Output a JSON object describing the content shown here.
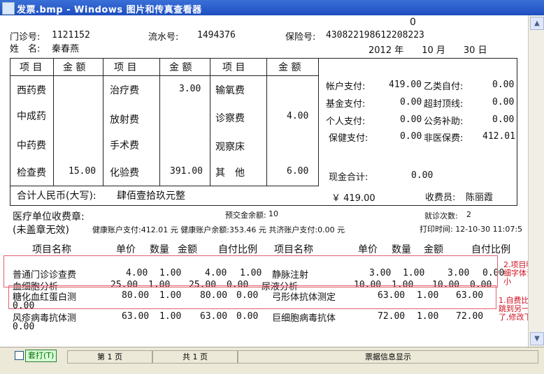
{
  "window": {
    "title": "发票.bmp - Windows 图片和传真查看器"
  },
  "scrollbar": {
    "up_icon": "▲",
    "down_icon": "▼"
  },
  "header": {
    "clinic_no_label": "门诊号:",
    "clinic_no": "1121152",
    "serial_label": "流水号:",
    "serial_no": "1494376",
    "insurance_label": "保险号:",
    "insurance_no": "430822198612208223",
    "name_label": "姓　名:",
    "name": "秦春燕",
    "date": "2012 年　　10 月　　30 日"
  },
  "fee_table": {
    "col_item": "项 目",
    "col_amount": "金 额",
    "rows": [
      [
        "西药费",
        "",
        "治疗费",
        "3.00",
        "输氧费",
        ""
      ],
      [
        "中成药",
        "",
        "放射费",
        "",
        "诊察费",
        "4.00"
      ],
      [
        "中药费",
        "",
        "手术费",
        "",
        "观察床",
        ""
      ],
      [
        "检查费",
        "15.00",
        "化验费",
        "391.00",
        "其　他",
        "6.00"
      ]
    ]
  },
  "payments": [
    {
      "label": "帐户支付:",
      "value": "419.00",
      "label2": "乙类自付:",
      "value2": "0.00"
    },
    {
      "label": "基金支付:",
      "value": "0.00",
      "label2": "超封顶线:",
      "value2": "0.00"
    },
    {
      "label": "个人支付:",
      "value": "0.00",
      "label2": "公务补助:",
      "value2": "0.00"
    },
    {
      "label": "保健支付:",
      "value": "0.00",
      "label2": "非医保费:",
      "value2": "412.01"
    }
  ],
  "cash_total": {
    "label": "现金合计:",
    "value": "0.00"
  },
  "total_row": {
    "label": "合计人民币(大写):",
    "value": "肆佰壹拾玖元整",
    "amount": "￥ 419.00",
    "cashier_label": "收费员:",
    "cashier": "陈丽霞"
  },
  "stamp_info": {
    "stamp_label": "医疗单位收费章:",
    "prepay_label": "预交金余额:",
    "prepay": "10",
    "visits_label": "就诊次数:",
    "visits": "2",
    "unstamped": "(未盖章无效)",
    "line2": "健康账户支付:412.01 元 健康账户余额:353.46 元 共济账户支付:0.00 元",
    "print_time": "打印时间: 12-10-30 11:07:5"
  },
  "items_header": {
    "c1": "项目名称",
    "c2": "单价",
    "c3": "数量",
    "c4": "金额",
    "c5": "自付比例"
  },
  "items": {
    "row1": {
      "name": "普通门诊诊查费",
      "price": "4.00",
      "qty": "1.00",
      "amt": "4.00",
      "ratio": "1.00",
      "name2": "静脉注射",
      "price2": "3.00",
      "qty2": "1.00",
      "amt2": "3.00",
      "ratio2": "0.00"
    },
    "row2": {
      "name": "血细胞分析",
      "price": "25.00",
      "qty": "1.00",
      "amt": "25.00",
      "ratio": "0.00",
      "name2": "尿液分析",
      "price2": "10.00",
      "qty2": "1.00",
      "amt2": "10.00",
      "ratio2": "0.00"
    },
    "row3": {
      "name": "糖化血红蛋白测",
      "price": "80.00",
      "qty": "1.00",
      "amt": "80.00",
      "ratio": "0.00",
      "name2": "弓形体抗体测定",
      "price2": "63.00",
      "qty2": "1.00",
      "amt2": "63.00",
      "wrap": "0.00"
    },
    "row4": {
      "name": "风疹病毒抗体测",
      "price": "63.00",
      "qty": "1.00",
      "amt": "63.00",
      "ratio": "0.00",
      "name2": "巨细胞病毒抗体",
      "price2": "72.00",
      "qty2": "1.00",
      "amt2": "72.00",
      "wrap": "0.00"
    }
  },
  "notes": {
    "note1": "2.项目明\n细字体调\n小",
    "note2": "1.自费比例\n跳到另一行\n了,修改下"
  },
  "top_zero": "0",
  "statusbar": {
    "print_btn": "套打(T)",
    "page_label": "第 1 页",
    "total_label": "共 1 页",
    "info_label": "票据信息显示"
  }
}
